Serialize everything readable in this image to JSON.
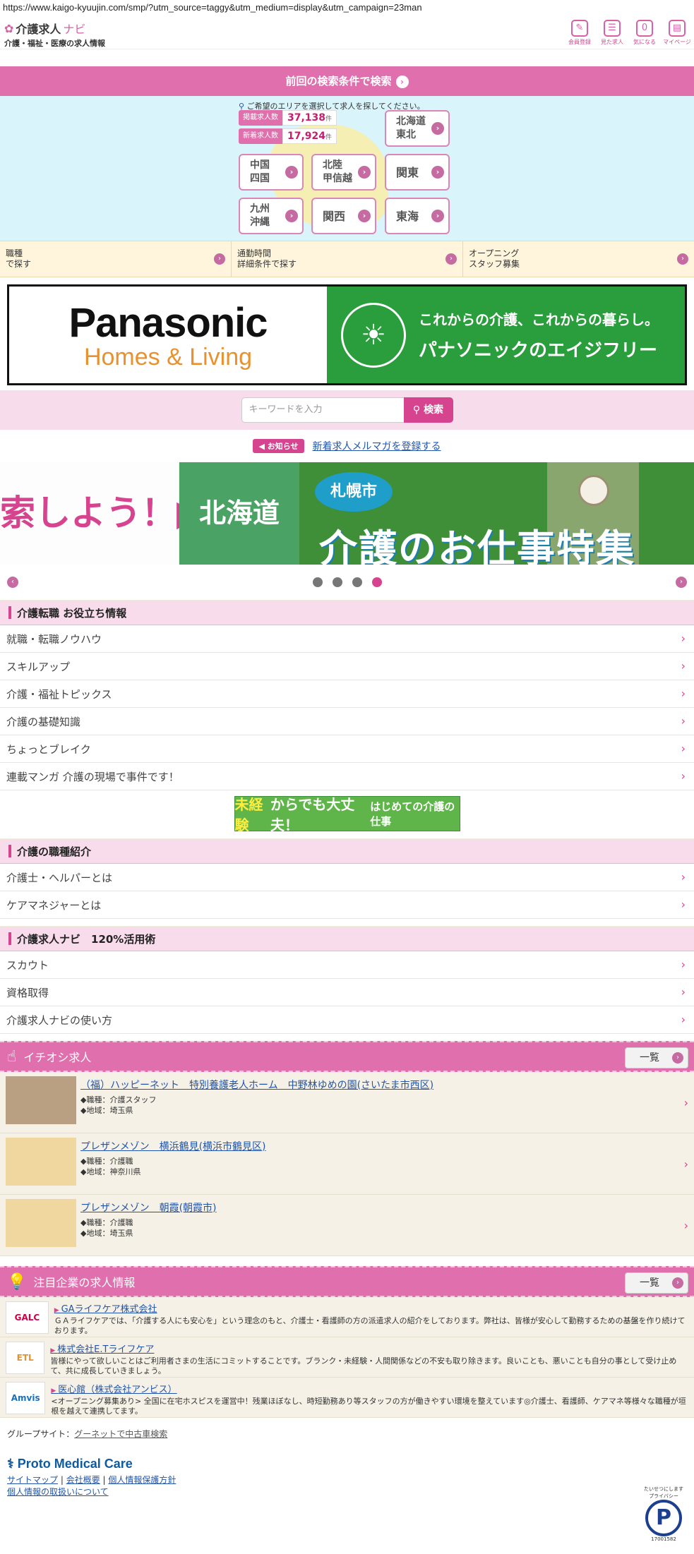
{
  "browser": {
    "url": "https://www.kaigo-kyuujin.com/smp/?utm_source=taggy&utm_medium=display&utm_campaign=23man"
  },
  "header": {
    "logo_main": "介護求人",
    "logo_navi": "ナビ",
    "logo_sub": "介護・福祉・医療の求人情報",
    "icons": [
      {
        "name": "member-register",
        "label": "会員登録"
      },
      {
        "name": "viewed-jobs",
        "label": "見た求人"
      },
      {
        "name": "favorites",
        "label": "気になる",
        "badge": "0"
      },
      {
        "name": "mypage",
        "label": "マイページ"
      }
    ]
  },
  "prev_search": {
    "label": "前回の検索条件で検索"
  },
  "area": {
    "hint": "ご希望のエリアを選択して求人を探してください。",
    "counts": [
      {
        "label": "掲載求人数",
        "value": "37,138",
        "unit": "件"
      },
      {
        "label": "新着求人数",
        "value": "17,924",
        "unit": "件"
      }
    ],
    "regions": [
      {
        "id": "hokkaido",
        "line1": "北海道",
        "line2": "東北"
      },
      {
        "id": "chugoku",
        "line1": "中国",
        "line2": "四国"
      },
      {
        "id": "hokuriku",
        "line1": "北陸",
        "line2": "甲信越"
      },
      {
        "id": "kanto",
        "line1": "関東",
        "line2": ""
      },
      {
        "id": "kyushu",
        "line1": "九州",
        "line2": "沖縄"
      },
      {
        "id": "kansai",
        "line1": "関西",
        "line2": ""
      },
      {
        "id": "tokai",
        "line1": "東海",
        "line2": ""
      }
    ]
  },
  "search_modes": [
    {
      "line1": "職種",
      "line2": "で探す"
    },
    {
      "line1": "通勤時間",
      "line2": "詳細条件で探す"
    },
    {
      "line1": "オープニング",
      "line2": "スタッフ募集"
    }
  ],
  "banner": {
    "brand": "Panasonic",
    "sub": "Homes & Living",
    "copy1": "これからの介護、これからの暮らし。",
    "copy2": "パナソニックのエイジフリー"
  },
  "search": {
    "placeholder": "キーワードを入力",
    "button": "検索"
  },
  "notice": {
    "tag": "お知らせ",
    "link": "新着求人メルマガを登録する"
  },
  "slider": {
    "prev_text": "索しよう！▶",
    "region": "北海道",
    "city": "札幌市",
    "headline": "介護のお仕事特集"
  },
  "useful": {
    "title": "介護転職 お役立ち情報",
    "items": [
      "就職・転職ノウハウ",
      "スキルアップ",
      "介護・福祉トピックス",
      "介護の基礎知識",
      "ちょっとブレイク",
      "連載マンガ 介護の現場で事件です！"
    ]
  },
  "mikeiken": {
    "part1": "未経験",
    "part2": "からでも大丈夫！",
    "part3": "はじめての介護の仕事"
  },
  "jobtypes": {
    "title": "介護の職種紹介",
    "items": [
      "介護士・ヘルパーとは",
      "ケアマネジャーとは"
    ]
  },
  "howto": {
    "title": "介護求人ナビ　120%活用術",
    "items": [
      "スカウト",
      "資格取得",
      "介護求人ナビの使い方"
    ]
  },
  "featured": {
    "title": "イチオシ求人",
    "more": "一覧",
    "jobs": [
      {
        "title": "（福）ハッピーネット　特別養護老人ホーム　中野林ゆめの園(さいたま市西区)",
        "type": "◆職種：介護スタッフ",
        "place": "◆地域：埼玉県"
      },
      {
        "title": "プレザンメゾン　横浜鶴見(横浜市鶴見区)",
        "type": "◆職種：介護職",
        "place": "◆地域：神奈川県"
      },
      {
        "title": "プレザンメゾン　朝霞(朝霞市)",
        "type": "◆職種：介護職",
        "place": "◆地域：埼玉県"
      }
    ]
  },
  "companies": {
    "title": "注目企業の求人情報",
    "more": "一覧",
    "items": [
      {
        "logo": "GALC",
        "name": "GAライフケア株式会社",
        "desc": "ＧＡライフケアでは、「介護する人にも安心を」という理念のもと、介護士・看護師の方の派遣求人の紹介をしております。弊社は、皆様が安心して勤務するための基盤を作り続けております。"
      },
      {
        "logo": "ETL",
        "name": "株式会社E.Tライフケア",
        "desc": "皆様にやって欲しいことはご利用者さまの生活にコミットすることです。ブランク・未経験・人間関係などの不安も取り除きます。良いことも、悪いことも自分の事として受け止めて、共に成長していきましょう。"
      },
      {
        "logo": "Amvis",
        "name": "医心館（株式会社アンビス）",
        "desc": "<オープニング募集あり> 全国に在宅ホスピスを運営中！残業ほぼなし、時短勤務あり等スタッフの方が働きやすい環境を整えています◎介護士、看護師、ケアマネ等様々な職種が垣根を越えて連携してます。"
      }
    ]
  },
  "footer": {
    "group_label": "グループサイト：",
    "group_link": "グーネットで中古車検索",
    "company": "Proto Medical Care",
    "links": [
      "サイトマップ",
      "会社概要",
      "個人情報保護方針",
      "個人情報の取扱いについて"
    ],
    "pmark_number": "17001582",
    "pmark_top": "たいせつにしますプライバシー"
  }
}
